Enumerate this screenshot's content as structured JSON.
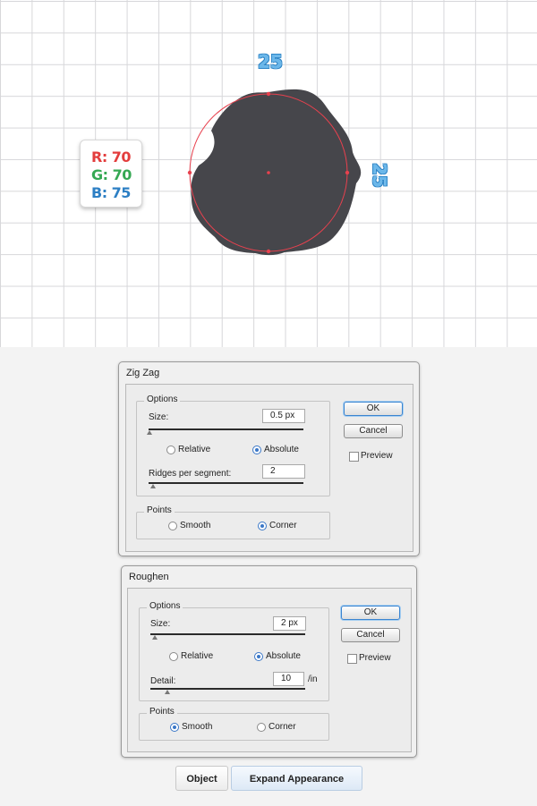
{
  "canvas": {
    "dimension_top": "25",
    "dimension_right": "25",
    "color_readout": {
      "r": "R: 70",
      "g": "G: 70",
      "b": "B: 75"
    },
    "shape_fill": "#46464b",
    "guide_color": "#e8414e"
  },
  "zigzag": {
    "title": "Zig Zag",
    "options_label": "Options",
    "size_label": "Size:",
    "size_value": "0.5 px",
    "relative_label": "Relative",
    "absolute_label": "Absolute",
    "selected_mode": "Absolute",
    "ridges_label": "Ridges per segment:",
    "ridges_value": "2",
    "points_label": "Points",
    "smooth_label": "Smooth",
    "corner_label": "Corner",
    "selected_points": "Corner",
    "ok_label": "OK",
    "cancel_label": "Cancel",
    "preview_label": "Preview",
    "preview_checked": false
  },
  "roughen": {
    "title": "Roughen",
    "options_label": "Options",
    "size_label": "Size:",
    "size_value": "2 px",
    "relative_label": "Relative",
    "absolute_label": "Absolute",
    "selected_mode": "Absolute",
    "detail_label": "Detail:",
    "detail_value": "10",
    "detail_unit": "/in",
    "points_label": "Points",
    "smooth_label": "Smooth",
    "corner_label": "Corner",
    "selected_points": "Smooth",
    "ok_label": "OK",
    "cancel_label": "Cancel",
    "preview_label": "Preview",
    "preview_checked": false
  },
  "menu_path": {
    "object_label": "Object",
    "expand_label": "Expand Appearance"
  }
}
